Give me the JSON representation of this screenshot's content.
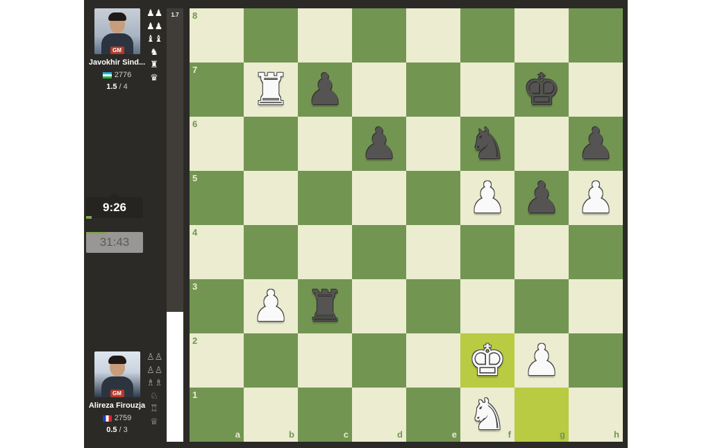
{
  "players": {
    "top": {
      "name": "Javokhir Sind...",
      "title": "GM",
      "rating": "2776",
      "score": "1.5",
      "score_total": " / 4",
      "flag": "uz-flag",
      "captured": [
        "♟♟",
        "♟♟",
        "♝♝",
        "♞",
        "♜",
        "♛"
      ],
      "clock": "9:26"
    },
    "bottom": {
      "name": "Alireza Firouzja",
      "title": "GM",
      "rating": "2759",
      "score": "0.5",
      "score_total": " / 3",
      "flag": "fr-flag",
      "captured": [
        "♙♙",
        "♙♙",
        "♗♗",
        "♘",
        "♖",
        "♕"
      ],
      "clock": "31:43"
    }
  },
  "eval": {
    "label": "1.7",
    "white_fraction": 0.3
  },
  "board": {
    "orientation": "white",
    "colors": {
      "light": "#ebecd0",
      "dark": "#739552",
      "highlight": "#b9ca43"
    },
    "ranks": [
      "8",
      "7",
      "6",
      "5",
      "4",
      "3",
      "2",
      "1"
    ],
    "files": [
      "a",
      "b",
      "c",
      "d",
      "e",
      "f",
      "g",
      "h"
    ],
    "highlights": [
      "f2",
      "g1"
    ],
    "pieces": [
      {
        "square": "b7",
        "glyph": "♜",
        "side": "w",
        "name": "white-rook"
      },
      {
        "square": "c7",
        "glyph": "♟",
        "side": "b",
        "name": "black-pawn"
      },
      {
        "square": "g7",
        "glyph": "♚",
        "side": "b",
        "name": "black-king"
      },
      {
        "square": "d6",
        "glyph": "♟",
        "side": "b",
        "name": "black-pawn"
      },
      {
        "square": "f6",
        "glyph": "♞",
        "side": "b",
        "name": "black-knight"
      },
      {
        "square": "h6",
        "glyph": "♟",
        "side": "b",
        "name": "black-pawn"
      },
      {
        "square": "f5",
        "glyph": "♟",
        "side": "w",
        "name": "white-pawn"
      },
      {
        "square": "g5",
        "glyph": "♟",
        "side": "b",
        "name": "black-pawn"
      },
      {
        "square": "h5",
        "glyph": "♟",
        "side": "w",
        "name": "white-pawn"
      },
      {
        "square": "b3",
        "glyph": "♟",
        "side": "w",
        "name": "white-pawn"
      },
      {
        "square": "c3",
        "glyph": "♜",
        "side": "b",
        "name": "black-rook"
      },
      {
        "square": "f2",
        "glyph": "♚",
        "side": "w",
        "name": "white-king"
      },
      {
        "square": "g2",
        "glyph": "♟",
        "side": "w",
        "name": "white-pawn"
      },
      {
        "square": "f1",
        "glyph": "♞",
        "side": "w",
        "name": "white-knight"
      }
    ]
  }
}
